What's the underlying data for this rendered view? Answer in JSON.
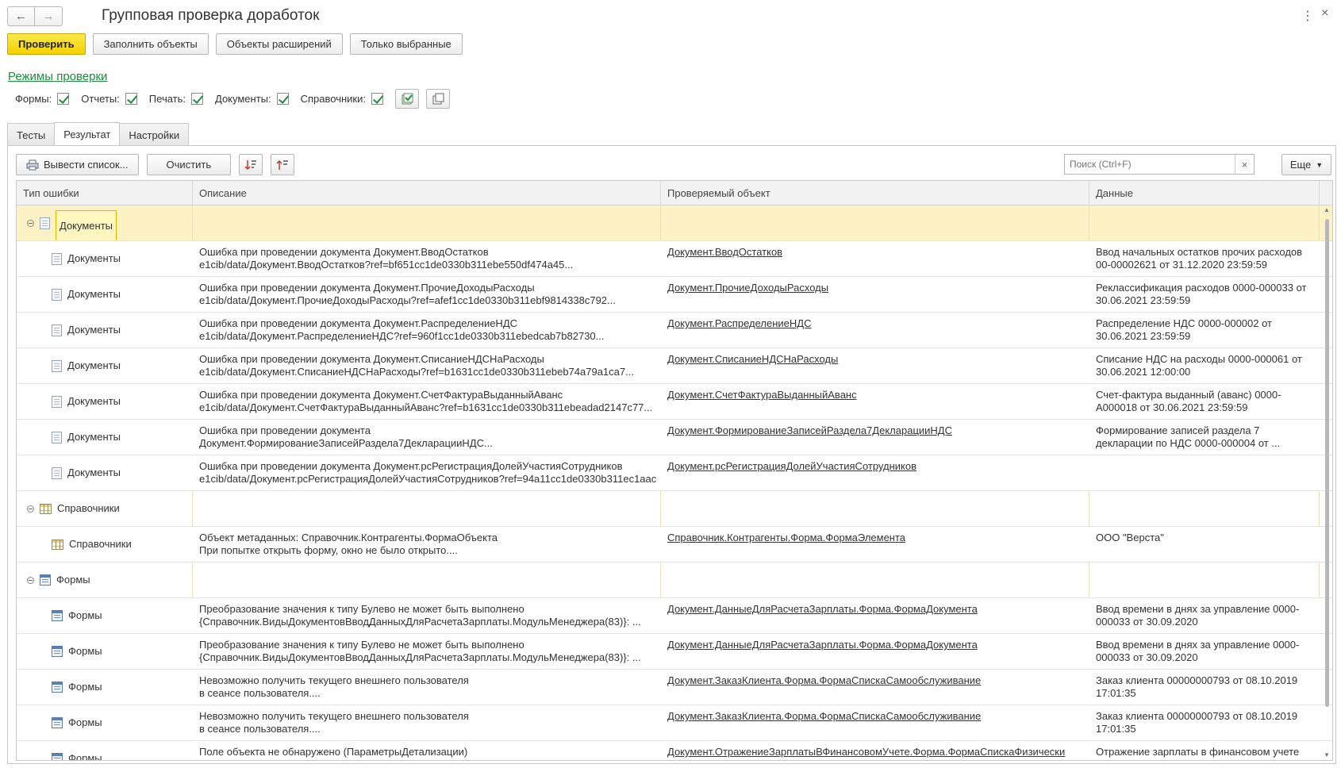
{
  "window": {
    "title": "Групповая проверка доработок",
    "back_icon": "arrow-left-icon",
    "forward_icon": "arrow-right-icon"
  },
  "toolbar": {
    "check_label": "Проверить",
    "fill_label": "Заполнить объекты",
    "ext_label": "Объекты расширений",
    "selected_label": "Только выбранные"
  },
  "modes": {
    "link": "Режимы проверки",
    "forms_label": "Формы:",
    "reports_label": "Отчеты:",
    "print_label": "Печать:",
    "docs_label": "Документы:",
    "catalogs_label": "Справочники:"
  },
  "tabs": [
    "Тесты",
    "Результат",
    "Настройки"
  ],
  "panel": {
    "export_label": "Вывести список...",
    "clear_label": "Очистить",
    "search_placeholder": "Поиск (Ctrl+F)",
    "more_label": "Еще"
  },
  "table": {
    "headers": [
      "Тип ошибки",
      "Описание",
      "Проверяемый объект",
      "Данные"
    ],
    "rows": [
      {
        "kind": "group",
        "icon": "doc",
        "type": "Документы",
        "desc1": "",
        "desc2": "",
        "object": "",
        "data": ""
      },
      {
        "kind": "item",
        "icon": "doc",
        "type": "Документы",
        "desc1": "Ошибка при проведении документа Документ.ВводОстатков",
        "desc2": "e1cib/data/Документ.ВводОстатков?ref=bf651cc1de0330b311ebe550df474a45...",
        "object": "Документ.ВводОстатков",
        "data": "Ввод начальных остатков прочих расходов 00-00002621 от 31.12.2020 23:59:59"
      },
      {
        "kind": "item",
        "icon": "doc",
        "type": "Документы",
        "desc1": "Ошибка при проведении документа Документ.ПрочиеДоходыРасходы",
        "desc2": "e1cib/data/Документ.ПрочиеДоходыРасходы?ref=afef1cc1de0330b311ebf9814338c792...",
        "object": "Документ.ПрочиеДоходыРасходы",
        "data": "Реклассификация расходов 0000-000033 от 30.06.2021 23:59:59"
      },
      {
        "kind": "item",
        "icon": "doc",
        "type": "Документы",
        "desc1": "Ошибка при проведении документа Документ.РаспределениеНДС",
        "desc2": "e1cib/data/Документ.РаспределениеНДС?ref=960f1cc1de0330b311ebedcab7b82730...",
        "object": "Документ.РаспределениеНДС",
        "data": "Распределение НДС 0000-000002 от 30.06.2021 23:59:59"
      },
      {
        "kind": "item",
        "icon": "doc",
        "type": "Документы",
        "desc1": "Ошибка при проведении документа Документ.СписаниеНДСНаРасходы",
        "desc2": "e1cib/data/Документ.СписаниеНДСНаРасходы?ref=b1631cc1de0330b311ebeb74a79a1ca7...",
        "object": "Документ.СписаниеНДСНаРасходы",
        "data": "Списание НДС на расходы 0000-000061 от 30.06.2021 12:00:00"
      },
      {
        "kind": "item",
        "icon": "doc",
        "type": "Документы",
        "desc1": "Ошибка при проведении документа Документ.СчетФактураВыданныйАванс",
        "desc2": "e1cib/data/Документ.СчетФактураВыданныйАванс?ref=b1631cc1de0330b311ebeadad2147c77...",
        "object": "Документ.СчетФактураВыданныйАванс",
        "data": "Счет-фактура выданный (аванс) 0000-А000018 от 30.06.2021 23:59:59"
      },
      {
        "kind": "item",
        "icon": "doc",
        "type": "Документы",
        "desc1": "Ошибка при проведении документа",
        "desc2": "Документ.ФормированиеЗаписейРаздела7ДекларацииНДС...",
        "object": "Документ.ФормированиеЗаписейРаздела7ДекларацииНДС",
        "data": "Формирование записей раздела 7 декларации по НДС 0000-000004 от ..."
      },
      {
        "kind": "item",
        "icon": "doc",
        "type": "Документы",
        "desc1": "Ошибка при проведении документа Документ.рсРегистрацияДолейУчастияСотрудников",
        "desc2": "e1cib/data/Документ.рсРегистрацияДолейУчастияСотрудников?ref=94a11cc1de0330b311ec1aac",
        "object": "Документ.рсРегистрацияДолейУчастияСотрудников",
        "data": ""
      },
      {
        "kind": "group",
        "icon": "table",
        "type": "Справочники",
        "desc1": "",
        "desc2": "",
        "object": "",
        "data": ""
      },
      {
        "kind": "item",
        "icon": "table",
        "type": "Справочники",
        "desc1": "Объект метаданных: Справочник.Контрагенты.ФормаОбъекта",
        "desc2": "При попытке открыть форму, окно не было открыто....",
        "object": "Справочник.Контрагенты.Форма.ФормаЭлемента",
        "data": "ООО \"Верста\""
      },
      {
        "kind": "group",
        "icon": "form",
        "type": "Формы",
        "desc1": "",
        "desc2": "",
        "object": "",
        "data": ""
      },
      {
        "kind": "item",
        "icon": "form",
        "type": "Формы",
        "desc1": "Преобразование значения к типу Булево не может быть выполнено",
        "desc2": "{Справочник.ВидыДокументовВводДанныхДляРасчетаЗарплаты.МодульМенеджера(83)}:    ...",
        "object": "Документ.ДанныеДляРасчетаЗарплаты.Форма.ФормаДокумента",
        "data": "Ввод времени в днях за управление 0000-000033 от 30.09.2020"
      },
      {
        "kind": "item",
        "icon": "form",
        "type": "Формы",
        "desc1": "Преобразование значения к типу Булево не может быть выполнено",
        "desc2": "{Справочник.ВидыДокументовВводДанныхДляРасчетаЗарплаты.МодульМенеджера(83)}:    ...",
        "object": "Документ.ДанныеДляРасчетаЗарплаты.Форма.ФормаДокумента",
        "data": "Ввод времени в днях за управление 0000-000033 от 30.09.2020"
      },
      {
        "kind": "item",
        "icon": "form",
        "type": "Формы",
        "desc1": "Невозможно получить текущего внешнего пользователя",
        "desc2": "в сеансе пользователя....",
        "object": "Документ.ЗаказКлиента.Форма.ФормаСпискаСамообслуживание",
        "data": "Заказ клиента 00000000793 от 08.10.2019 17:01:35"
      },
      {
        "kind": "item",
        "icon": "form",
        "type": "Формы",
        "desc1": "Невозможно получить текущего внешнего пользователя",
        "desc2": "в сеансе пользователя....",
        "object": "Документ.ЗаказКлиента.Форма.ФормаСпискаСамообслуживание",
        "data": "Заказ клиента 00000000793 от 08.10.2019 17:01:35"
      },
      {
        "kind": "item",
        "icon": "form",
        "type": "Формы",
        "desc1": "Поле объекта не обнаружено (ПараметрыДетализации)",
        "desc2": "",
        "object": "Документ.ОтражениеЗарплатыВФинансовомУчете.Форма.ФормаСпискаФизически",
        "data": "Отражение зарплаты в финансовом учете"
      }
    ]
  }
}
